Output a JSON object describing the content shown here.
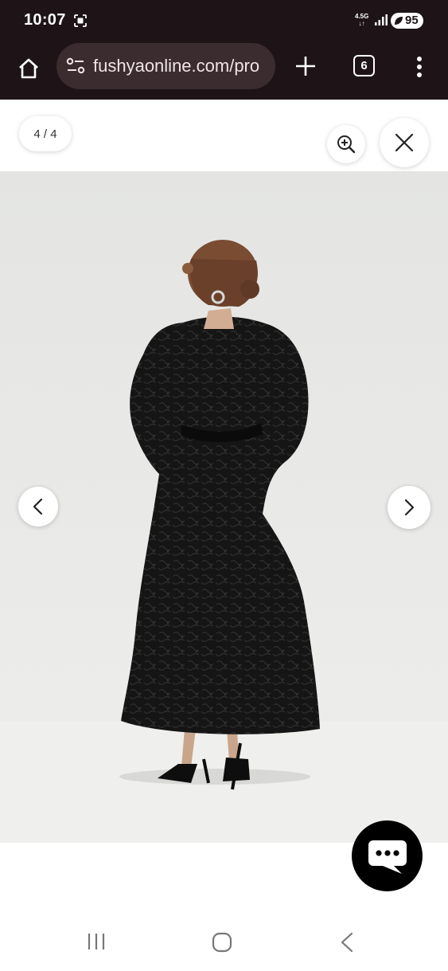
{
  "status_bar": {
    "time": "10:07",
    "network_label_top": "4.5G",
    "network_label_bottom": "↓↑",
    "battery_level": "95",
    "icons": [
      "screenshot-icon",
      "signal-icon",
      "battery-saver-leaf-icon"
    ]
  },
  "browser": {
    "url": "fushyaonline.com/pro",
    "tab_count": "6",
    "icons": [
      "home-icon",
      "site-settings-icon",
      "new-tab-plus-icon",
      "tabs-icon",
      "more-vert-icon"
    ]
  },
  "gallery": {
    "counter": "4 / 4",
    "icons": [
      "zoom-in-icon",
      "close-icon",
      "chevron-left-icon",
      "chevron-right-icon"
    ]
  },
  "chat": {
    "icon": "chat-bubble-icon"
  },
  "system_nav": {
    "icons": [
      "recent-apps-icon",
      "home-circle-icon",
      "back-icon"
    ]
  },
  "colors": {
    "browser_bar": "#1e1417",
    "url_pill": "#3b2c30",
    "image_backdrop": "#e9e9e7",
    "dress": "#151515",
    "chat_button": "#000000"
  }
}
